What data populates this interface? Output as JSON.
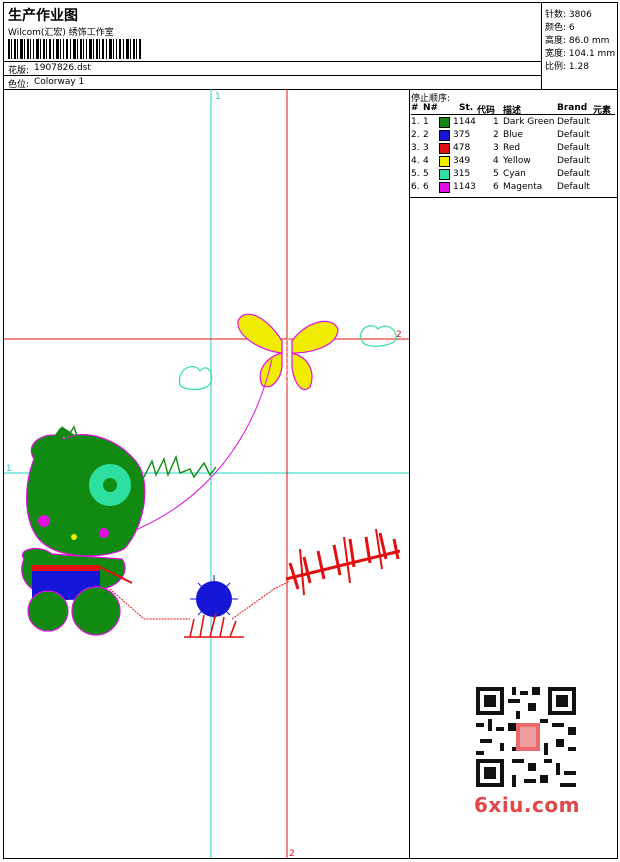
{
  "header": {
    "title": "生产作业图",
    "company": "Wilcom(汇宏) 绣饰工作室",
    "design_label": "花版:",
    "design_value": "1907826.dst",
    "colorway_label": "色位:",
    "colorway_value": "Colorway 1"
  },
  "stats": {
    "stitches_label": "针数:",
    "stitches_value": "3806",
    "colors_label": "颜色:",
    "colors_value": "6",
    "height_label": "高度:",
    "height_value": "86.0 mm",
    "width_label": "宽度:",
    "width_value": "104.1 mm",
    "scale_label": "比例:",
    "scale_value": "1.28"
  },
  "stop_sequence": {
    "title": "停止顺序:",
    "headers": {
      "num": "#",
      "needle": "N#",
      "stitches": "St.",
      "code": "代码",
      "desc": "描述",
      "brand": "Brand",
      "element": "元素"
    },
    "rows": [
      {
        "num": "1.",
        "needle": "1",
        "color": "#108a10",
        "stitches": "1144",
        "code": "1",
        "desc": "Dark Green",
        "brand": "Default"
      },
      {
        "num": "2.",
        "needle": "2",
        "color": "#1515d8",
        "stitches": "375",
        "code": "2",
        "desc": "Blue",
        "brand": "Default"
      },
      {
        "num": "3.",
        "needle": "3",
        "color": "#e01010",
        "stitches": "478",
        "code": "3",
        "desc": "Red",
        "brand": "Default"
      },
      {
        "num": "4.",
        "needle": "4",
        "color": "#f2ec00",
        "stitches": "349",
        "code": "4",
        "desc": "Yellow",
        "brand": "Default"
      },
      {
        "num": "5.",
        "needle": "5",
        "color": "#2ee0a0",
        "stitches": "315",
        "code": "5",
        "desc": "Cyan",
        "brand": "Default"
      },
      {
        "num": "6.",
        "needle": "6",
        "color": "#e010e0",
        "stitches": "1143",
        "code": "6",
        "desc": "Magenta",
        "brand": "Default"
      }
    ]
  },
  "canvas": {
    "guide_labels": {
      "cyan": "1",
      "red": "2"
    }
  },
  "watermark": "6xiu.com",
  "colors": {
    "cyan_guide": "#20d0c0",
    "red_guide": "#e01010"
  }
}
